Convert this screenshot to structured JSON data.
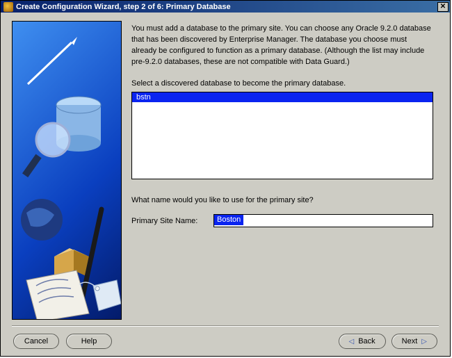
{
  "window": {
    "title": "Create Configuration Wizard, step 2 of 6: Primary Database"
  },
  "intro_text": "You must add a database to the primary site. You can choose any Oracle 9.2.0 database that has been discovered by Enterprise Manager. The database you choose must already be configured to function as a primary database. (Although the list may include pre-9.2.0 databases, these are not compatible with Data Guard.)",
  "select_label": "Select a discovered database to become the primary database.",
  "databases": [
    {
      "name": "bstn",
      "selected": true
    }
  ],
  "name_prompt": "What name would you like to use for the primary site?",
  "site_name_label": "Primary Site Name:",
  "site_name_value": "Boston",
  "buttons": {
    "cancel": "Cancel",
    "help": "Help",
    "back": "Back",
    "next": "Next"
  }
}
